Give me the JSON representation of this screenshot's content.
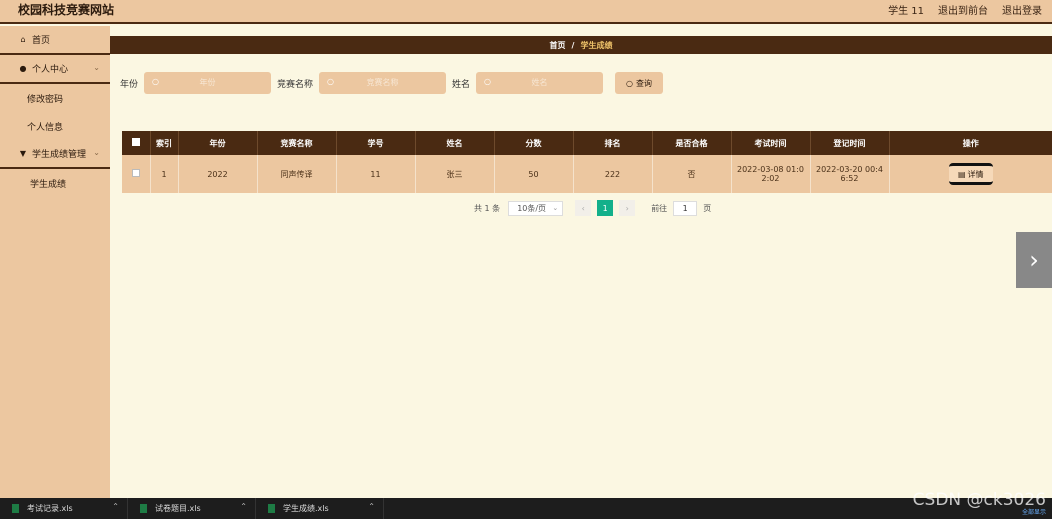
{
  "header": {
    "brand": "校园科技竞赛网站",
    "user": "学生 11",
    "exit_front": "退出到前台",
    "logout": "退出登录"
  },
  "sidebar": {
    "home": "首页",
    "personal_center": "个人中心",
    "change_password": "修改密码",
    "personal_info": "个人信息",
    "score_mgmt": "学生成绩管理",
    "student_scores": "学生成绩"
  },
  "breadcrumb": {
    "home": "首页",
    "separator": "/",
    "current": "学生成绩"
  },
  "search": {
    "year_label": "年份",
    "year_placeholder": "年份",
    "competition_label": "竞赛名称",
    "competition_placeholder": "竞赛名称",
    "name_label": "姓名",
    "name_placeholder": "姓名",
    "query_button": "查询"
  },
  "table": {
    "headers": [
      "索引",
      "年份",
      "竞赛名称",
      "学号",
      "姓名",
      "分数",
      "排名",
      "是否合格",
      "考试时间",
      "登记时间",
      "操作"
    ],
    "rows": [
      {
        "index": "1",
        "year": "2022",
        "competition": "同声传译",
        "student_id": "11",
        "name": "张三",
        "score": "50",
        "rank": "222",
        "qualified": "否",
        "exam_time_1": "2022-03-08 01:0",
        "exam_time_2": "2:02",
        "reg_time_1": "2022-03-20 00:4",
        "reg_time_2": "6:52",
        "action": "详情"
      }
    ]
  },
  "pagination": {
    "total": "共 1 条",
    "page_size": "10条/页",
    "prev": "‹",
    "current_page": "1",
    "next": "›",
    "goto_label": "前往",
    "goto_value": "1",
    "page_unit": "页"
  },
  "taskbar": {
    "files": [
      "考试记录.xls",
      "试卷题目.xls",
      "学生成绩.xls"
    ],
    "show_all": "全部显示"
  },
  "watermark": "CSDN @ck3026"
}
